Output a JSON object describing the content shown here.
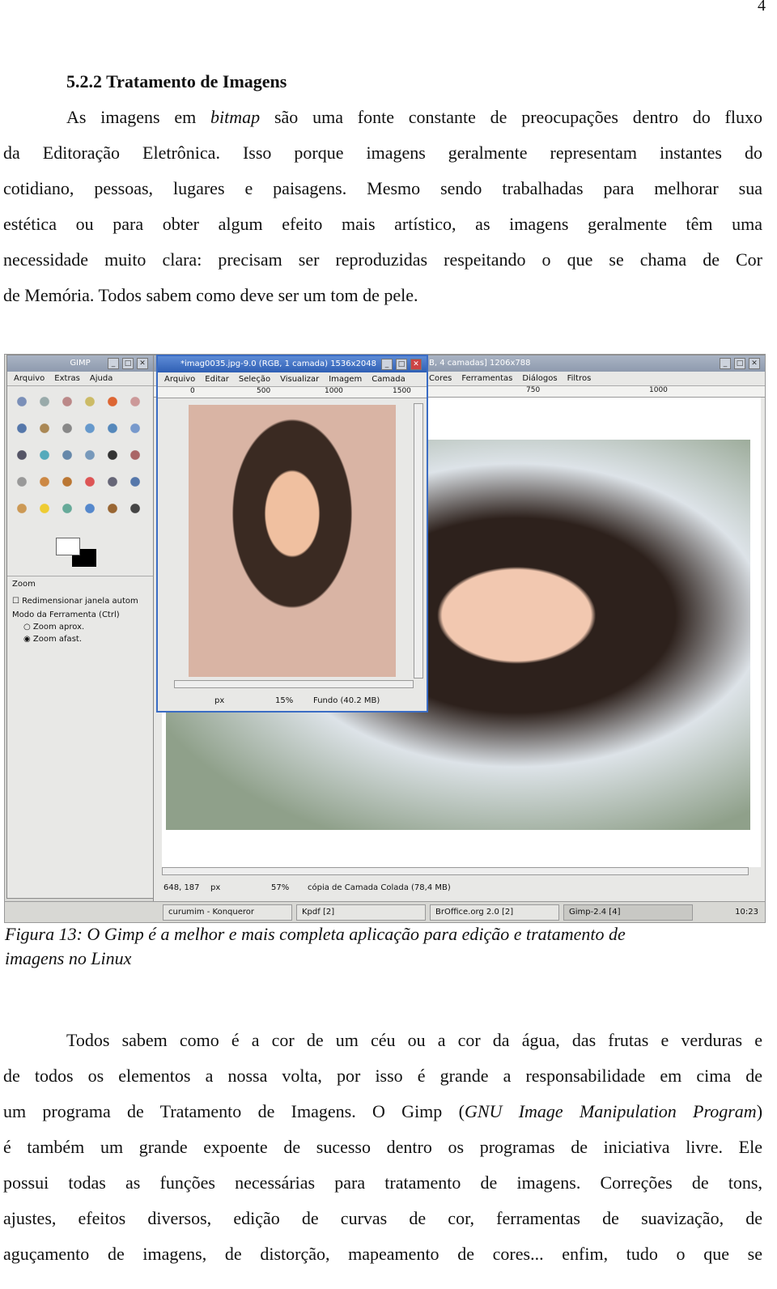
{
  "page_number": "4",
  "heading": "5.2.2 Tratamento de Imagens",
  "para1": [
    "As imagens em <i>bitmap</i> são uma fonte constante de preocupações dentro do fluxo",
    "da Editoração Eletrônica. Isso porque imagens geralmente representam instantes do",
    "cotidiano, pessoas, lugares e paisagens. Mesmo sendo trabalhadas para melhorar sua",
    "estética ou para obter algum efeito mais artístico, as imagens geralmente têm uma",
    "necessidade muito clara: precisam ser reproduzidas respeitando o que se chama de Cor",
    "de Memória. Todos sabem como deve ser um tom de pele."
  ],
  "screenshot": {
    "toolbox": {
      "title": "GIMP",
      "menu": [
        "Arquivo",
        "Extras",
        "Ajuda"
      ],
      "panel_title": "Zoom",
      "checkbox": "Redimensionar janela autom",
      "mode_label": "Modo da Ferramenta (Ctrl)",
      "radio1": "Zoom aprox.",
      "radio2": "Zoom afast."
    },
    "image1": {
      "title": "*imag0035.jpg-9.0 (RGB, 1 camada) 1536x2048",
      "menu": [
        "Arquivo",
        "Editar",
        "Seleção",
        "Visualizar",
        "Imagem",
        "Camada"
      ],
      "ruler": [
        "0",
        "500",
        "1000",
        "1500"
      ],
      "unit": "px",
      "zoom": "15%",
      "status": "Fundo (40.2 MB)"
    },
    "image2": {
      "title": "B, 4 camadas] 1206x788",
      "menu": [
        "Cores",
        "Ferramentas",
        "Diálogos",
        "Filtros"
      ],
      "ruler": [
        "750",
        "1000"
      ],
      "coords": "648, 187",
      "unit": "px",
      "zoom": "57%",
      "status": "cópia de Camada Colada (78,4 MB)"
    },
    "taskbar": {
      "items": [
        "curumim - Konqueror",
        "Kpdf [2]",
        "BrOffice.org 2.0 [2]",
        "Gimp-2.4 [4]"
      ],
      "clock": "10:23"
    }
  },
  "caption": [
    "Figura 13: O Gimp é a melhor e mais completa aplicação para edição e tratamento de",
    "imagens no Linux"
  ],
  "para2": [
    "Todos sabem como é a cor de um céu ou a cor da água, das frutas e verduras e",
    "de todos os elementos a nossa volta, por isso é grande a responsabilidade em cima de",
    "um programa de Tratamento de Imagens. O Gimp (<i>GNU Image Manipulation Program</i>)",
    "é também um grande expoente de sucesso dentro os programas de iniciativa livre. Ele",
    "possui todas as funções necessárias para tratamento de imagens. Correções de tons,",
    "ajustes, efeitos diversos, edição de curvas de cor, ferramentas de suavização, de",
    "aguçamento de imagens, de distorção, mapeamento de cores... enfim, tudo o que se"
  ]
}
